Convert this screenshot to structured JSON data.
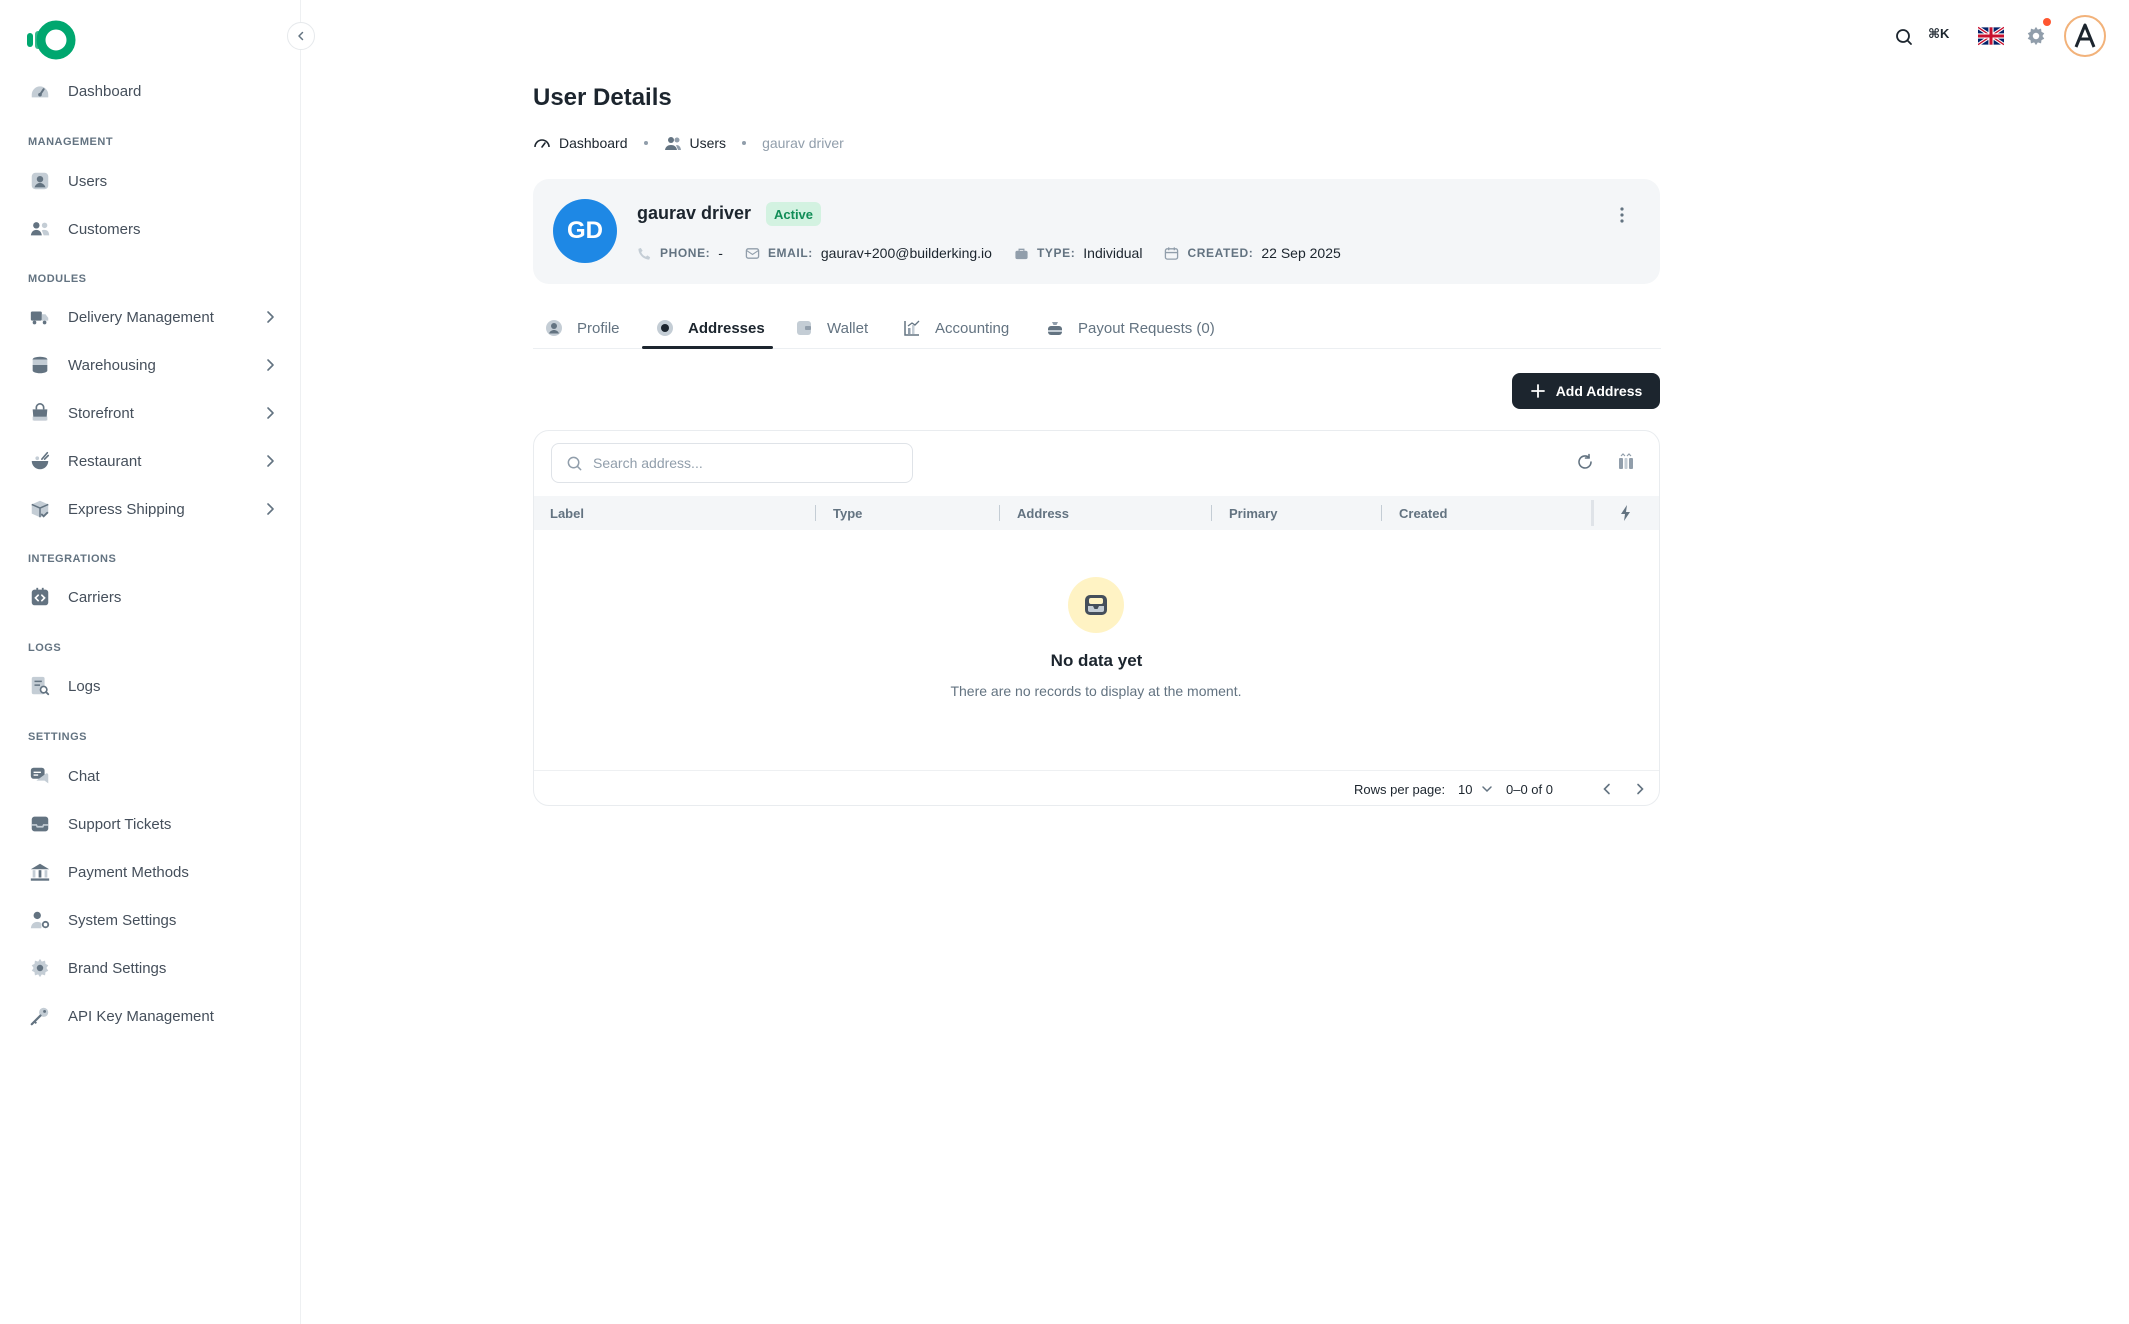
{
  "sidebar": {
    "collapse_icon": "chevron-left-icon",
    "dashboard": "Dashboard",
    "sections": {
      "management": "MANAGEMENT",
      "modules": "MODULES",
      "integrations": "INTEGRATIONS",
      "logs": "LOGS",
      "settings": "SETTINGS"
    },
    "items": {
      "users": "Users",
      "customers": "Customers",
      "delivery_management": "Delivery Management",
      "warehousing": "Warehousing",
      "storefront": "Storefront",
      "restaurant": "Restaurant",
      "express_shipping": "Express Shipping",
      "carriers": "Carriers",
      "logs": "Logs",
      "chat": "Chat",
      "support_tickets": "Support Tickets",
      "payment_methods": "Payment Methods",
      "system_settings": "System Settings",
      "brand_settings": "Brand Settings",
      "api_key_management": "API Key Management"
    }
  },
  "topbar": {
    "shortcut": "⌘K",
    "icons": [
      "search-icon",
      "uk-flag-icon",
      "gear-icon",
      "user-avatar"
    ]
  },
  "page": {
    "title": "User Details",
    "breadcrumb": {
      "dashboard": "Dashboard",
      "users": "Users",
      "current": "gaurav driver"
    }
  },
  "user": {
    "initials": "GD",
    "name": "gaurav driver",
    "status": "Active",
    "phone_label": "PHONE:",
    "phone": "-",
    "email_label": "EMAIL:",
    "email": "gaurav+200@builderking.io",
    "type_label": "TYPE:",
    "type": "Individual",
    "created_label": "CREATED:",
    "created": "22 Sep 2025"
  },
  "tabs": {
    "profile": "Profile",
    "addresses": "Addresses",
    "wallet": "Wallet",
    "accounting": "Accounting",
    "payout_requests": "Payout Requests (0)",
    "active": "addresses"
  },
  "actions": {
    "add_address": "Add Address"
  },
  "table": {
    "search_placeholder": "Search address...",
    "columns": {
      "label": "Label",
      "type": "Type",
      "address": "Address",
      "primary": "Primary",
      "created": "Created"
    },
    "rows": [],
    "empty_title": "No data yet",
    "empty_desc": "There are no records to display at the moment.",
    "rows_per_page_label": "Rows per page:",
    "rows_per_page": "10",
    "range": "0–0 of 0"
  },
  "colors": {
    "brand": "#00a76f",
    "primary_dark": "#1c252e",
    "avatar_blue": "#1e88e5",
    "status_green_bg": "#d3f2e1",
    "status_green_text": "#118d57",
    "notif": "#ff5630"
  }
}
